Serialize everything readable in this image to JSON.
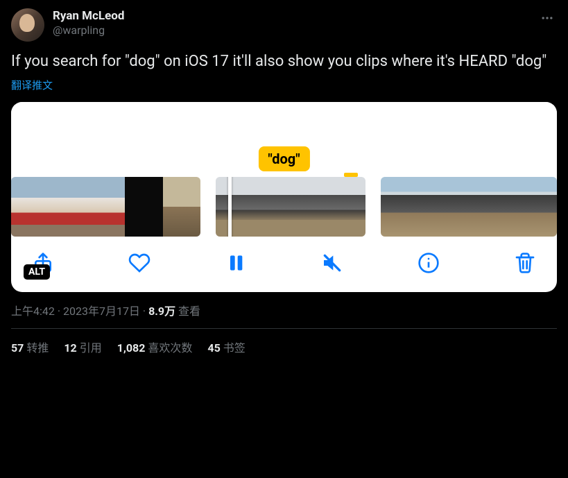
{
  "author": {
    "display_name": "Ryan McLeod",
    "handle": "@warpling"
  },
  "content_text": "If you search for \"dog\" on iOS 17 it'll also show you clips where it's HEARD \"dog\"",
  "translate_label": "翻译推文",
  "media": {
    "badge_text": "\"dog\"",
    "alt_label": "ALT"
  },
  "meta": {
    "time": "上午4:42",
    "date": "2023年7月17日",
    "views_count": "8.9万",
    "views_label": "查看"
  },
  "stats": {
    "retweets": {
      "count": "57",
      "label": "转推"
    },
    "quotes": {
      "count": "12",
      "label": "引用"
    },
    "likes": {
      "count": "1,082",
      "label": "喜欢次数"
    },
    "bookmarks": {
      "count": "45",
      "label": "书签"
    }
  }
}
